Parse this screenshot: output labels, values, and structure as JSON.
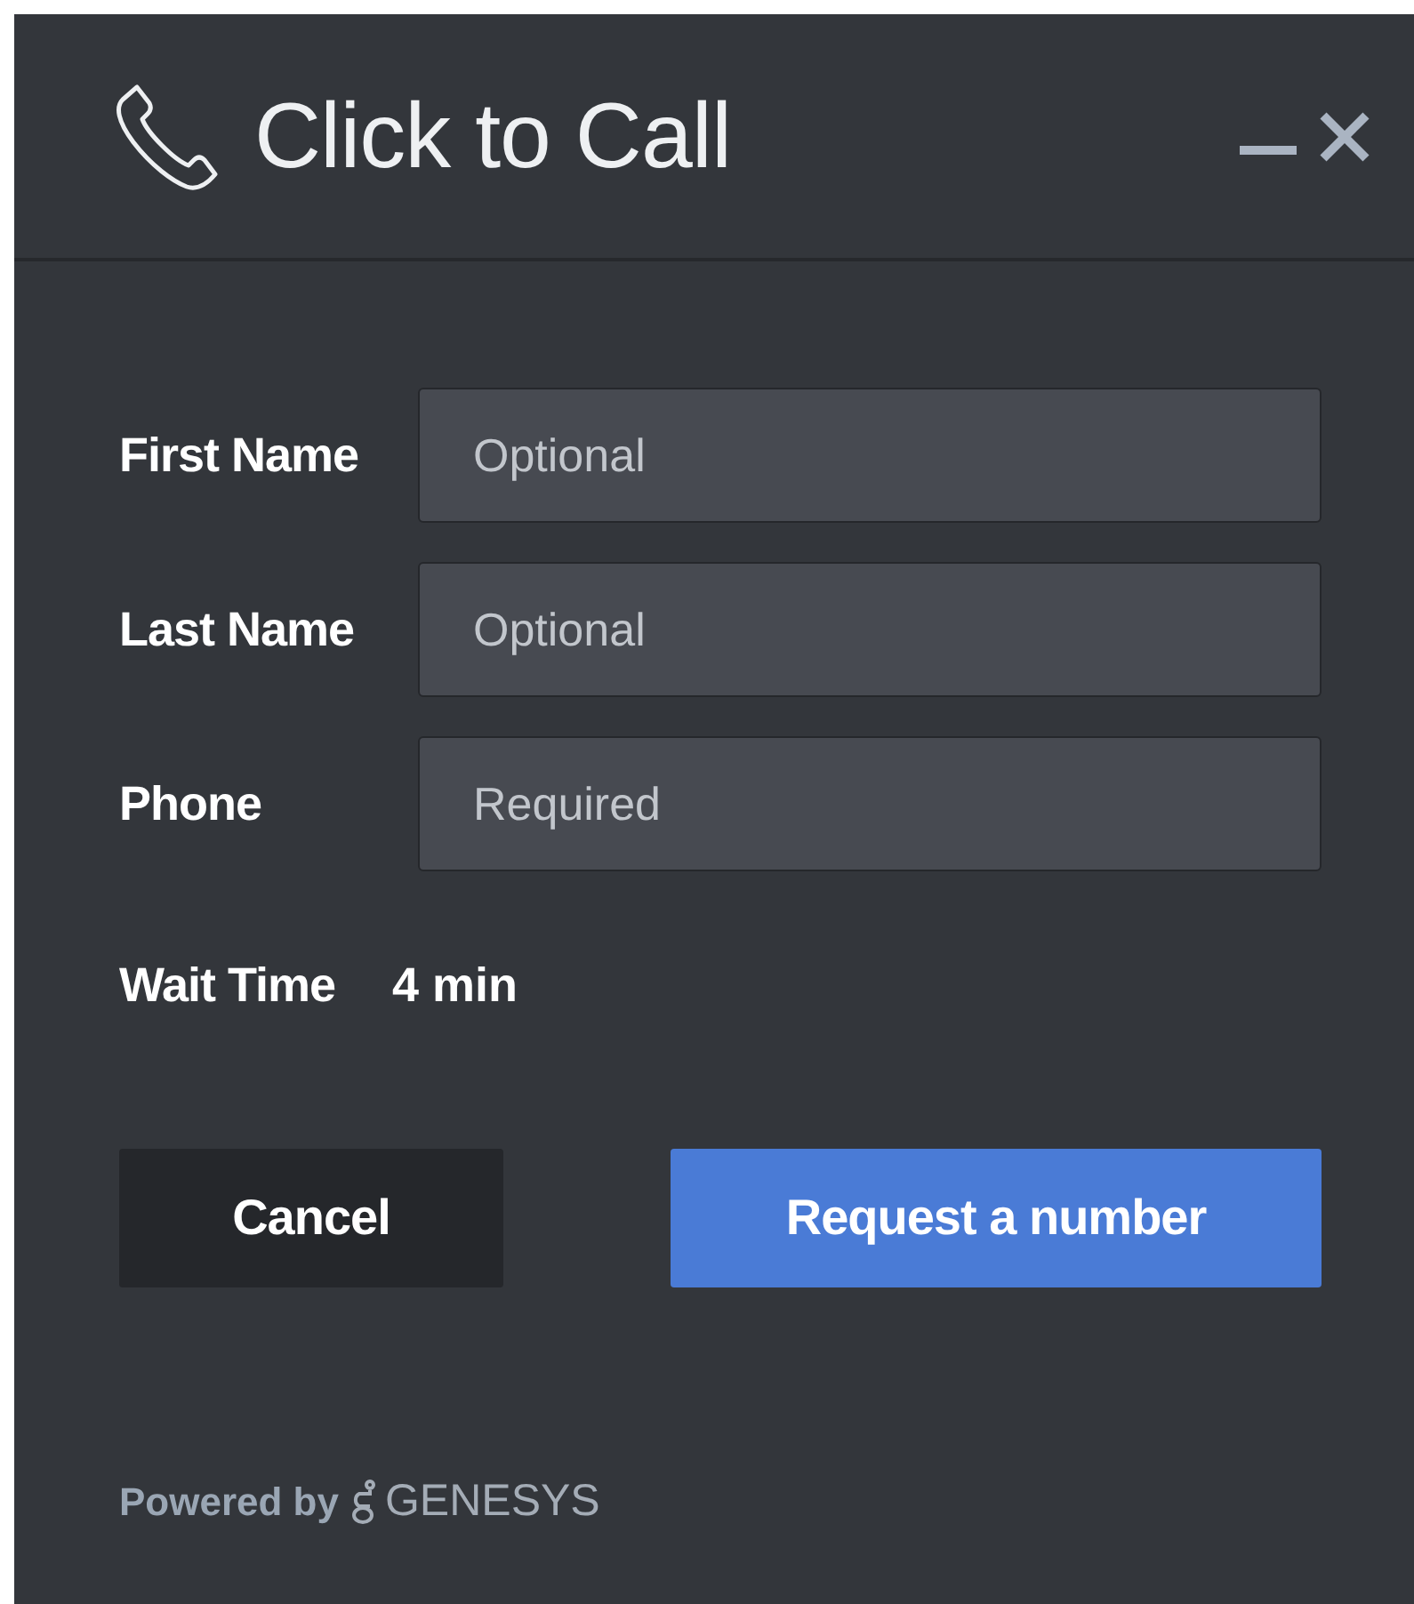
{
  "window": {
    "title": "Click to Call"
  },
  "fields": [
    {
      "label": "First Name",
      "placeholder": "Optional"
    },
    {
      "label": "Last Name",
      "placeholder": "Optional"
    },
    {
      "label": "Phone",
      "placeholder": "Required"
    }
  ],
  "wait_time": {
    "label": "Wait Time",
    "value": "4 min"
  },
  "buttons": [
    {
      "label": "Cancel",
      "kind": "secondary"
    },
    {
      "label": "Request a number",
      "kind": "primary"
    }
  ],
  "footer": {
    "powered_by": "Powered by",
    "brand": "GENESYS"
  }
}
